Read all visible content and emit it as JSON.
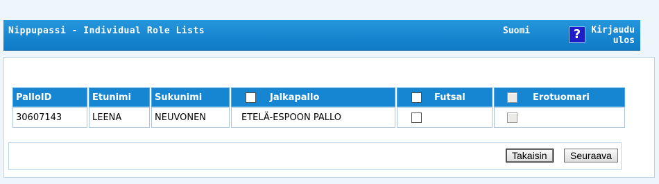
{
  "header": {
    "title": "Nippupassi - Individual Role Lists",
    "language": "Suomi",
    "help_symbol": "?",
    "logout_line1": "Kirjaudu",
    "logout_line2": "ulos"
  },
  "table": {
    "columns": [
      "PalloID",
      "Etunimi",
      "Sukunimi",
      "Jalkapallo",
      "Futsal",
      "Erotuomari"
    ],
    "rows": [
      {
        "palloid": "30607143",
        "etunimi": "LEENA",
        "sukunimi": "NEUVONEN",
        "jalkapallo": "ETELÄ-ESPOON PALLO",
        "futsal_checked": false,
        "erotuomari_checked": false
      }
    ],
    "header_checkboxes": {
      "jalkapallo": false,
      "futsal": false,
      "erotuomari": false
    }
  },
  "buttons": {
    "back_label": "Takaisin",
    "next_label": "Seuraava"
  }
}
